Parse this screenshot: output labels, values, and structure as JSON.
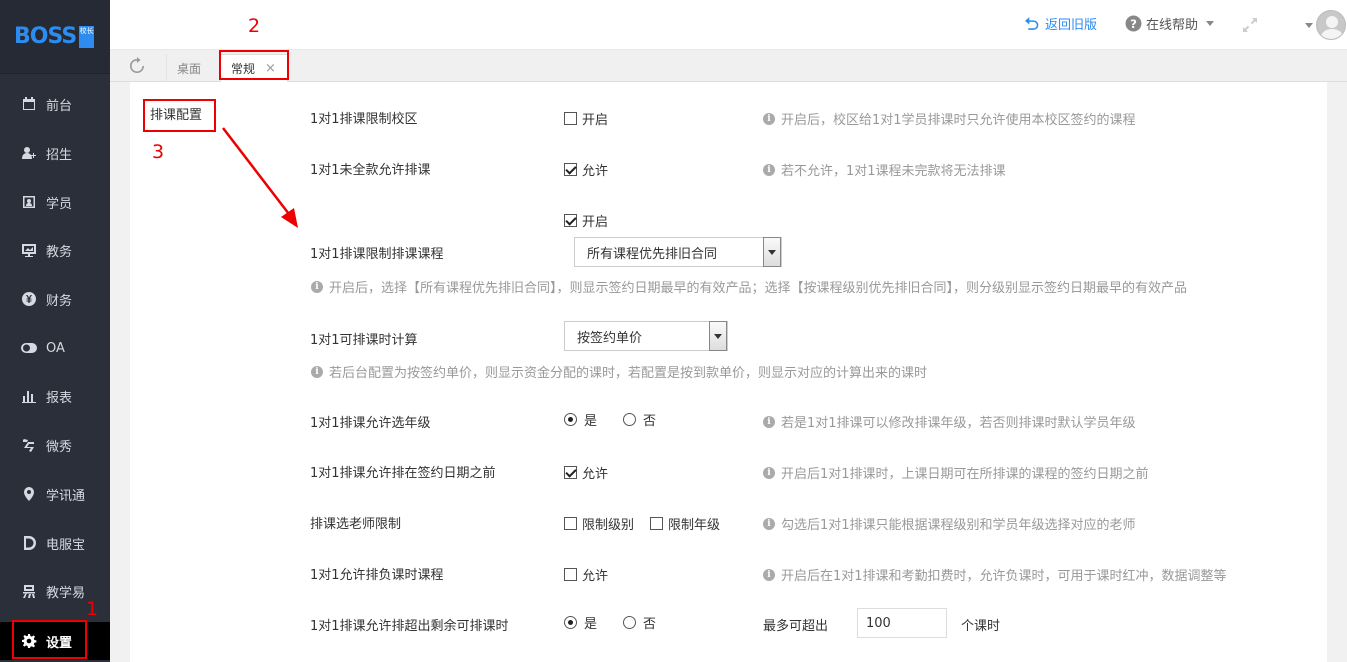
{
  "app": {
    "logo_text": "BOSS",
    "logo_badge": "校长"
  },
  "sidebar": {
    "items": [
      {
        "label": "前台",
        "icon": "calendar-icon"
      },
      {
        "label": "招生",
        "icon": "add-user-icon"
      },
      {
        "label": "学员",
        "icon": "id-card-icon"
      },
      {
        "label": "教务",
        "icon": "board-icon"
      },
      {
        "label": "财务",
        "icon": "yen-icon"
      },
      {
        "label": "OA",
        "icon": "toggle-icon"
      },
      {
        "label": "报表",
        "icon": "bar-chart-icon"
      },
      {
        "label": "微秀",
        "icon": "xiu-icon"
      },
      {
        "label": "学讯通",
        "icon": "location-pin-icon"
      },
      {
        "label": "电服宝",
        "icon": "phone-d-icon"
      },
      {
        "label": "教学易",
        "icon": "yi-icon"
      },
      {
        "label": "设置",
        "icon": "gear-icon",
        "active": true
      }
    ]
  },
  "header": {
    "back_label": "返回旧版",
    "help_label": "在线帮助"
  },
  "tabs": {
    "desk": "桌面",
    "general": "常规",
    "close": "×"
  },
  "section": {
    "title": "排课配置"
  },
  "settings": {
    "r1": {
      "label": "1对1排课限制校区",
      "opt": "开启",
      "checked": false,
      "hint": "开启后，校区给1对1学员排课时只允许使用本校区签约的课程"
    },
    "r2": {
      "label": "1对1未全款允许排课",
      "opt": "允许",
      "checked": true,
      "hint": "若不允许，1对1课程未完款将无法排课"
    },
    "r3": {
      "label": "1对1排课限制排课课程",
      "opt": "开启",
      "checked": true,
      "select": "所有课程优先排旧合同",
      "hint": "开启后，选择【所有课程优先排旧合同】，则显示签约日期最早的有效产品；选择【按课程级别优先排旧合同】，则分级别显示签约日期最早的有效产品"
    },
    "r4": {
      "label": "1对1可排课时计算",
      "select": "按签约单价",
      "hint": "若后台配置为按签约单价，则显示资金分配的课时，若配置是按到款单价，则显示对应的计算出来的课时"
    },
    "r5": {
      "label": "1对1排课允许选年级",
      "yes": "是",
      "no": "否",
      "hint": "若是1对1排课可以修改排课年级，若否则排课时默认学员年级"
    },
    "r6": {
      "label": "1对1排课允许排在签约日期之前",
      "opt": "允许",
      "checked": true,
      "hint": "开启后1对1排课时，上课日期可在所排课的课程的签约日期之前"
    },
    "r7": {
      "label": "排课选老师限制",
      "opt1": "限制级别",
      "opt2": "限制年级",
      "hint": "勾选后1对1排课只能根据课程级别和学员年级选择对应的老师"
    },
    "r8": {
      "label": "1对1允许排负课时课程",
      "opt": "允许",
      "checked": false,
      "hint": "开启后在1对1排课和考勤扣费时，允许负课时，可用于课时红冲，数据调整等"
    },
    "r9": {
      "label": "1对1排课允许排超出剩余可排课时",
      "yes": "是",
      "no": "否",
      "max_label": "最多可超出",
      "max_value": "100",
      "unit": "个课时"
    }
  },
  "annotations": {
    "n1": "1",
    "n2": "2",
    "n3": "3",
    "color": "#e00000"
  }
}
